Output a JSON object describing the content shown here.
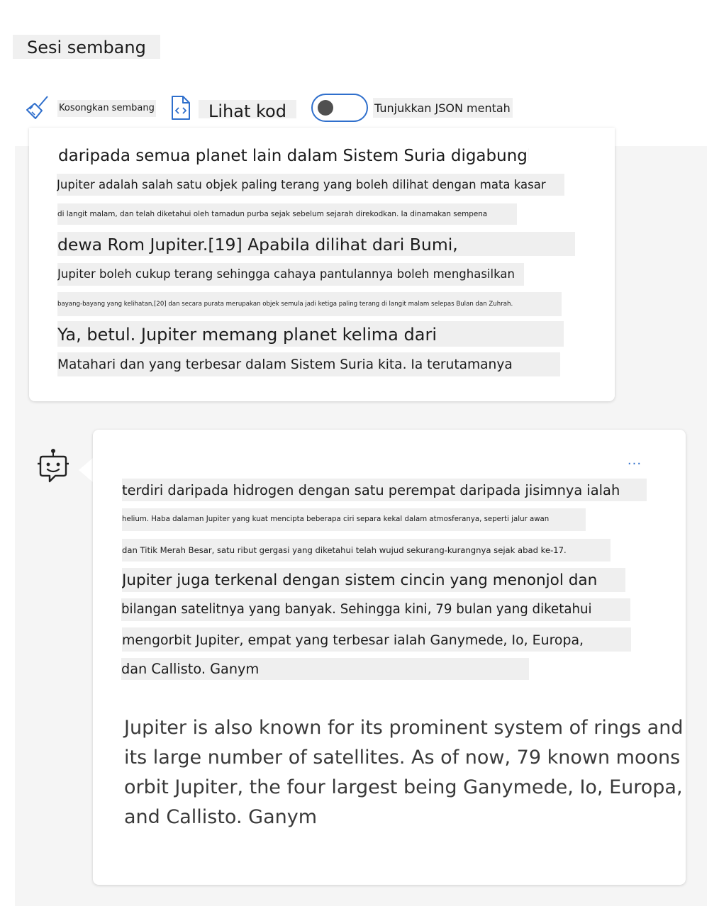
{
  "header": {
    "title": "Sesi sembang"
  },
  "toolbar": {
    "clear_label": "Kosongkan sembang",
    "clear_icon": "broom-icon",
    "code_label": "Lihat kod",
    "code_icon": "code-file-icon",
    "json_toggle_label": "Tunjukkan JSON mentah",
    "json_toggle_on": false
  },
  "user_message": {
    "lines": [
      "daripada semua planet lain dalam Sistem Suria digabungkan.",
      "Jupiter adalah salah satu objek paling terang yang boleh dilihat dengan mata kasar",
      "di langit malam, dan telah diketahui oleh tamadun purba sejak sebelum sejarah direkodkan. Ia dinamakan sempena",
      "dewa Rom Jupiter.[19] Apabila dilihat dari Bumi,",
      "Jupiter boleh cukup terang sehingga cahaya pantulannya boleh menghasilkan",
      "bayang-bayang yang kelihatan,[20] dan secara purata merupakan objek semula jadi ketiga paling terang di langit malam selepas Bulan dan Zuhrah.",
      "Ya, betul. Jupiter memang planet kelima dari",
      "Matahari dan yang terbesar dalam Sistem Suria kita. Ia terutamanya"
    ]
  },
  "bot_message": {
    "avatar_icon": "bot-icon",
    "more_label": "...",
    "lines": [
      "terdiri daripada hidrogen dengan satu perempat daripada jisimnya ialah",
      "helium. Haba dalaman Jupiter yang kuat mencipta beberapa ciri separa kekal dalam atmosferanya, seperti jalur awan",
      "dan Titik Merah Besar, satu ribut gergasi yang diketahui telah wujud sekurang-kurangnya sejak abad ke-17.",
      "Jupiter juga terkenal dengan sistem cincin yang menonjol dan",
      "bilangan satelitnya yang banyak. Sehingga kini, 79 bulan yang diketahui",
      "mengorbit Jupiter, empat yang terbesar ialah Ganymede, Io, Europa,",
      "dan Callisto. Ganym"
    ],
    "english_lines": [
      "Jupiter is also known for its prominent system of rings and",
      "its large number of satellites. As of now, 79 known moons",
      "orbit Jupiter, the four largest being Ganymede, Io, Europa,",
      "and Callisto. Ganym"
    ]
  }
}
